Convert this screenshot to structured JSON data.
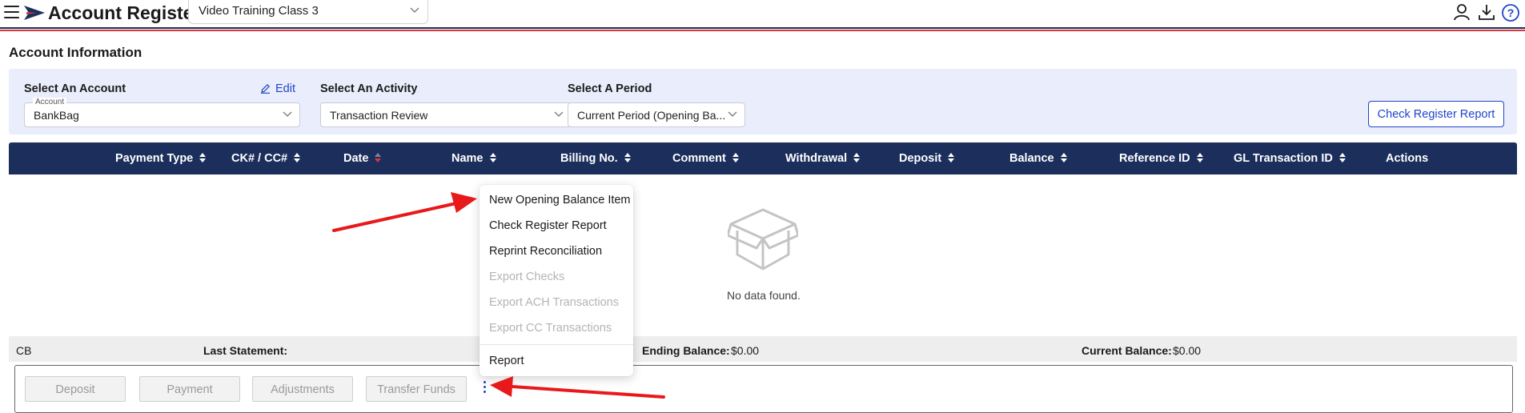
{
  "header": {
    "app_title": "Account Register",
    "company": "Video Training Class 3",
    "icons": [
      "menu-icon",
      "flag-logo-icon",
      "user-icon",
      "download-icon",
      "help-icon"
    ]
  },
  "account_info": {
    "title": "Account Information",
    "account": {
      "label": "Select An Account",
      "edit": "Edit",
      "floating_label": "Account",
      "value": "BankBag"
    },
    "activity": {
      "label": "Select An Activity",
      "value": "Transaction Review"
    },
    "period": {
      "label": "Select A Period",
      "value": "Current Period (Opening Ba..."
    },
    "report_button": "Check Register Report"
  },
  "table": {
    "columns": [
      "Payment Type",
      "CK# / CC#",
      "Date",
      "Name",
      "Billing No.",
      "Comment",
      "Withdrawal",
      "Deposit",
      "Balance",
      "Reference ID",
      "GL Transaction ID",
      "Actions"
    ],
    "sorted_column": "Date",
    "empty_text": "No data found."
  },
  "summary": {
    "code": "CB",
    "last_statement_label": "Last Statement:",
    "ending_balance_label": "Ending Balance:",
    "ending_balance_value": "$0.00",
    "current_balance_label": "Current Balance:",
    "current_balance_value": "$0.00"
  },
  "actions": {
    "deposit": "Deposit",
    "payment": "Payment",
    "adjustments": "Adjustments",
    "transfer": "Transfer Funds"
  },
  "menu": {
    "items": [
      {
        "label": "New Opening Balance Item",
        "enabled": true
      },
      {
        "label": "Check Register Report",
        "enabled": true
      },
      {
        "label": "Reprint Reconciliation",
        "enabled": true
      },
      {
        "label": "Export Checks",
        "enabled": false
      },
      {
        "label": "Export ACH Transactions",
        "enabled": false
      },
      {
        "label": "Export CC Transactions",
        "enabled": false
      },
      {
        "label": "Report",
        "enabled": true
      }
    ]
  },
  "colors": {
    "navy": "#1b2e5c",
    "accent_red": "#d6363b",
    "link_blue": "#2046c9",
    "panel_bg": "#eaedfb",
    "annotation_arrow": "#e8191b"
  }
}
